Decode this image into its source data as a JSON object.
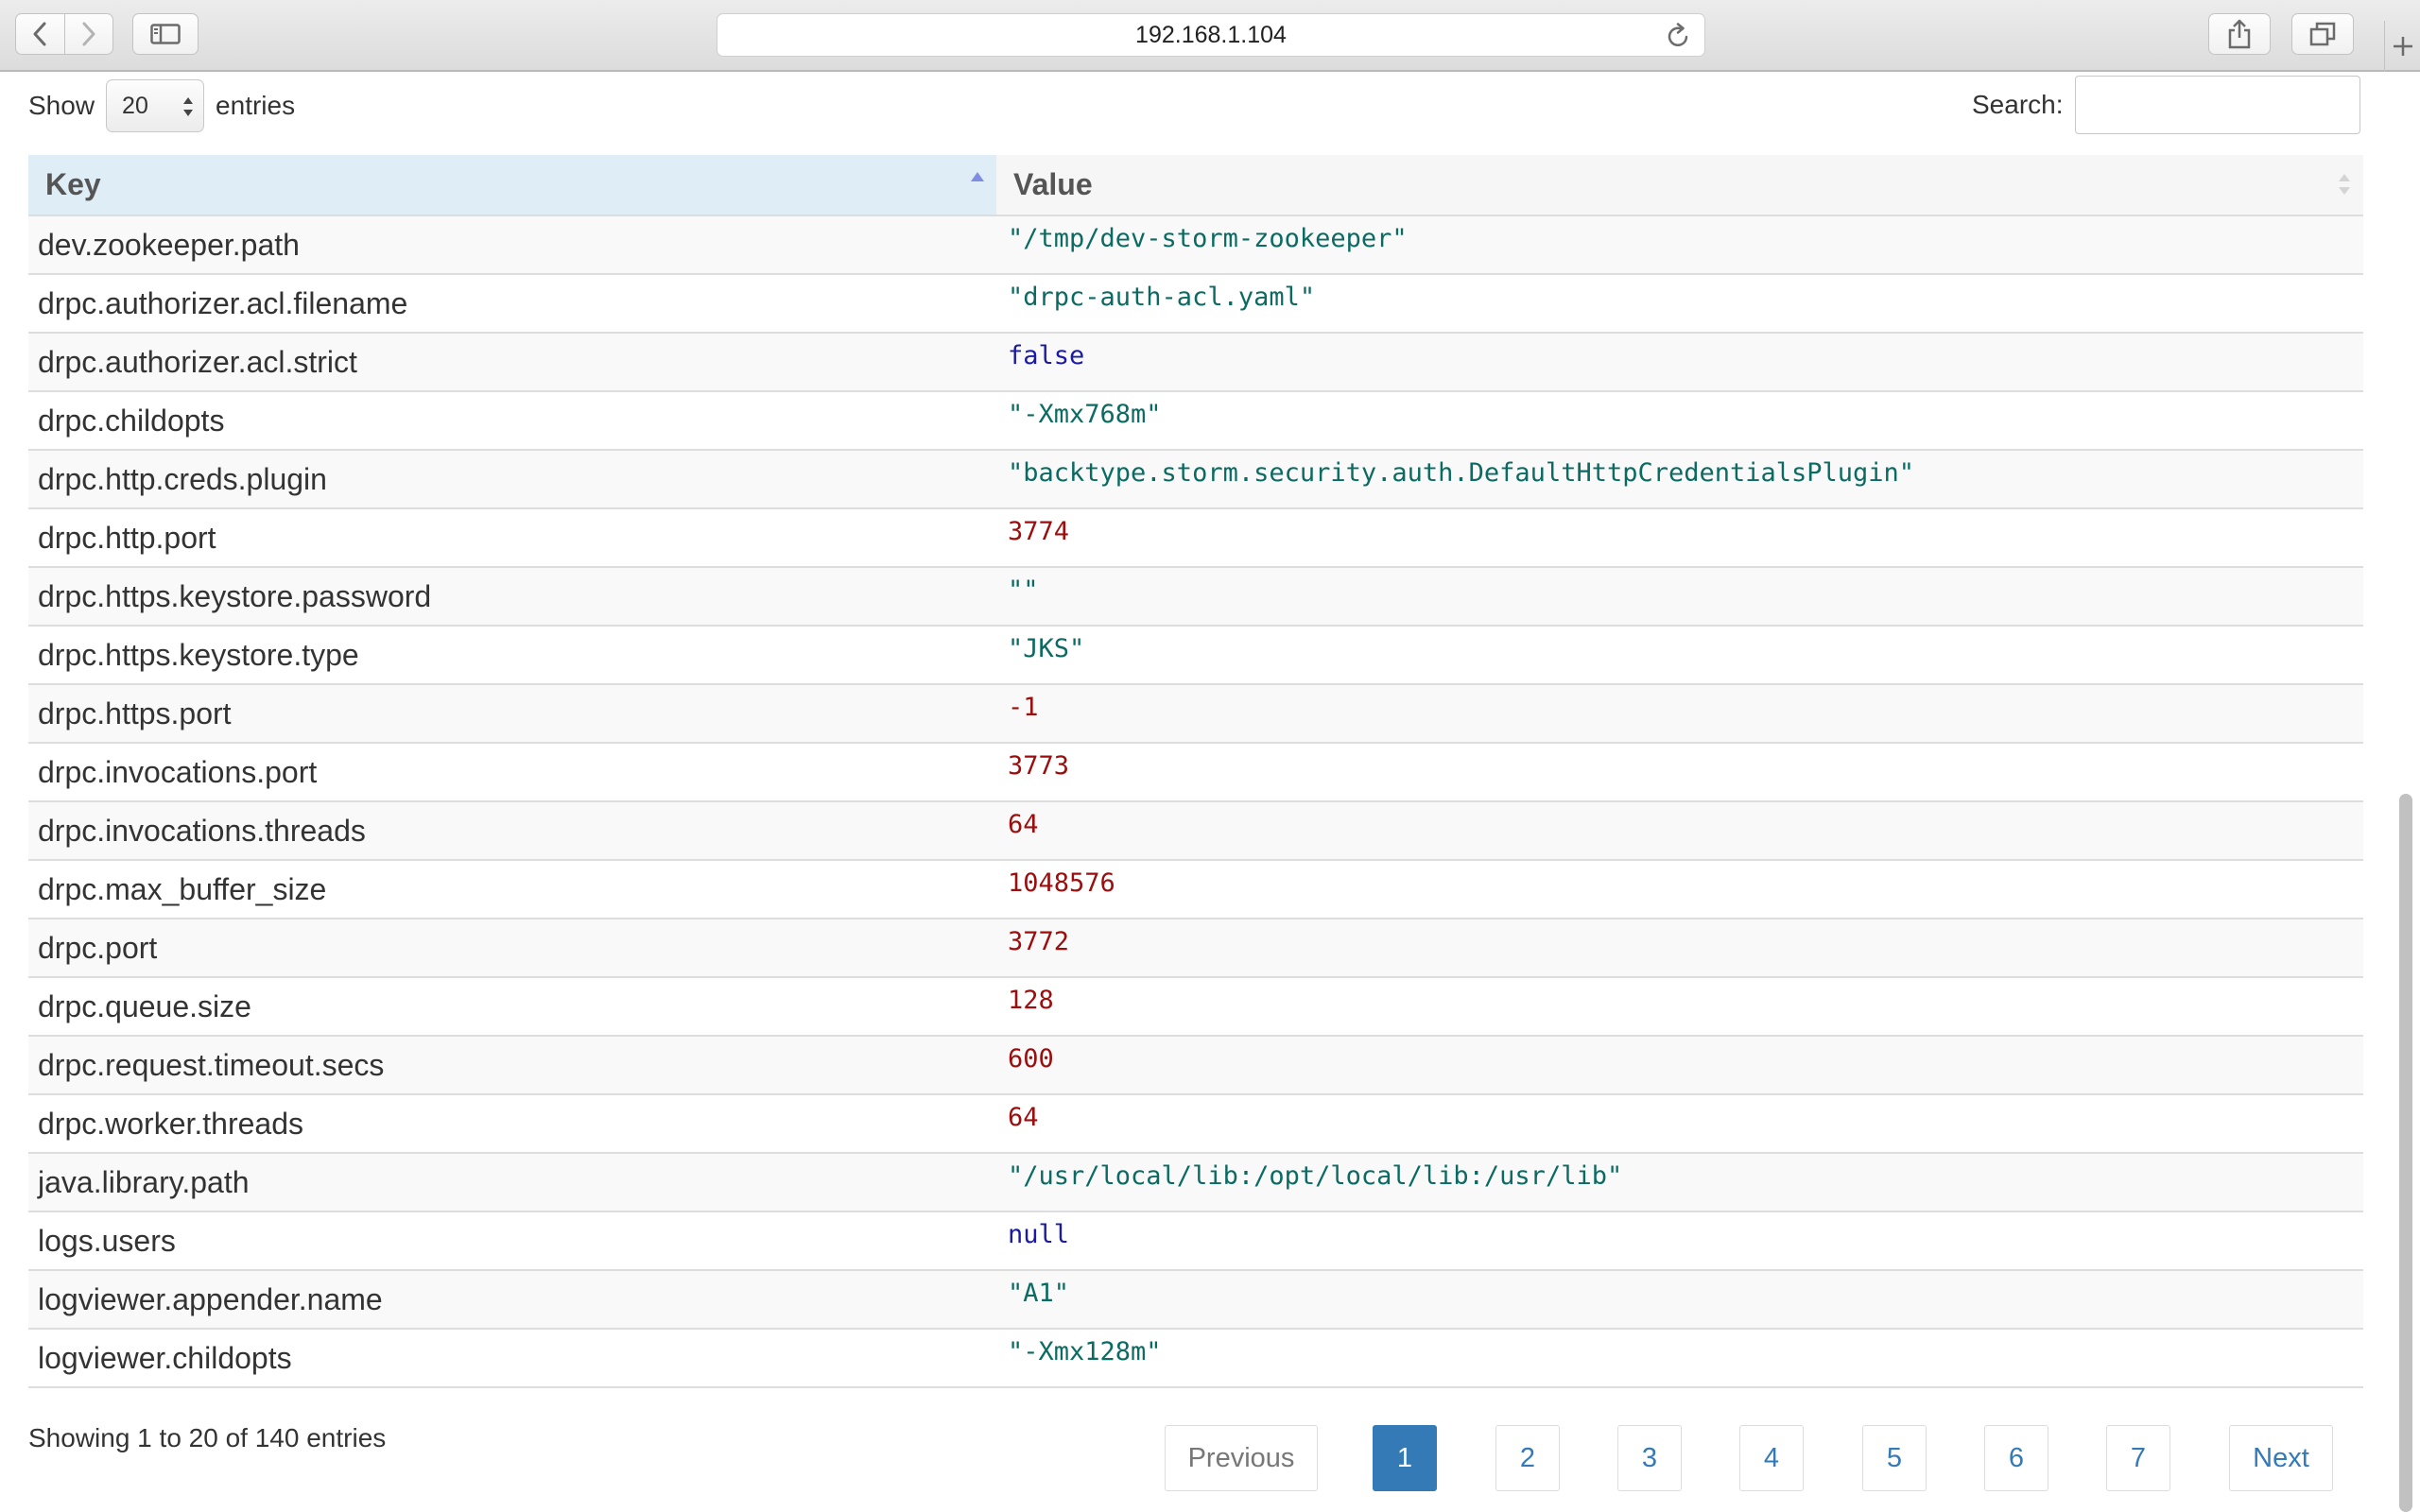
{
  "browser": {
    "url": "192.168.1.104"
  },
  "controls": {
    "show_label": "Show",
    "entries_label": "entries",
    "length_value": "20",
    "search_label": "Search:",
    "search_value": ""
  },
  "table": {
    "columns": [
      "Key",
      "Value"
    ],
    "sorted_column": "Key",
    "sort_direction": "ascending",
    "value_colors": {
      "string": "#0b6b62",
      "number": "#9c0d0d",
      "literal": "#1a1aa6"
    },
    "rows": [
      {
        "key": "dev.zookeeper.path",
        "value": "\"/tmp/dev-storm-zookeeper\"",
        "type": "string"
      },
      {
        "key": "drpc.authorizer.acl.filename",
        "value": "\"drpc-auth-acl.yaml\"",
        "type": "string"
      },
      {
        "key": "drpc.authorizer.acl.strict",
        "value": "false",
        "type": "literal"
      },
      {
        "key": "drpc.childopts",
        "value": "\"-Xmx768m\"",
        "type": "string"
      },
      {
        "key": "drpc.http.creds.plugin",
        "value": "\"backtype.storm.security.auth.DefaultHttpCredentialsPlugin\"",
        "type": "string"
      },
      {
        "key": "drpc.http.port",
        "value": "3774",
        "type": "number"
      },
      {
        "key": "drpc.https.keystore.password",
        "value": "\"\"",
        "type": "string"
      },
      {
        "key": "drpc.https.keystore.type",
        "value": "\"JKS\"",
        "type": "string"
      },
      {
        "key": "drpc.https.port",
        "value": "-1",
        "type": "number"
      },
      {
        "key": "drpc.invocations.port",
        "value": "3773",
        "type": "number"
      },
      {
        "key": "drpc.invocations.threads",
        "value": "64",
        "type": "number"
      },
      {
        "key": "drpc.max_buffer_size",
        "value": "1048576",
        "type": "number"
      },
      {
        "key": "drpc.port",
        "value": "3772",
        "type": "number"
      },
      {
        "key": "drpc.queue.size",
        "value": "128",
        "type": "number"
      },
      {
        "key": "drpc.request.timeout.secs",
        "value": "600",
        "type": "number"
      },
      {
        "key": "drpc.worker.threads",
        "value": "64",
        "type": "number"
      },
      {
        "key": "java.library.path",
        "value": "\"/usr/local/lib:/opt/local/lib:/usr/lib\"",
        "type": "string"
      },
      {
        "key": "logs.users",
        "value": "null",
        "type": "literal"
      },
      {
        "key": "logviewer.appender.name",
        "value": "\"A1\"",
        "type": "string"
      },
      {
        "key": "logviewer.childopts",
        "value": "\"-Xmx128m\"",
        "type": "string"
      }
    ]
  },
  "footer": {
    "info": "Showing 1 to 20 of 140 entries",
    "previous_label": "Previous",
    "next_label": "Next",
    "pages": [
      "1",
      "2",
      "3",
      "4",
      "5",
      "6",
      "7"
    ],
    "current_page": "1"
  }
}
